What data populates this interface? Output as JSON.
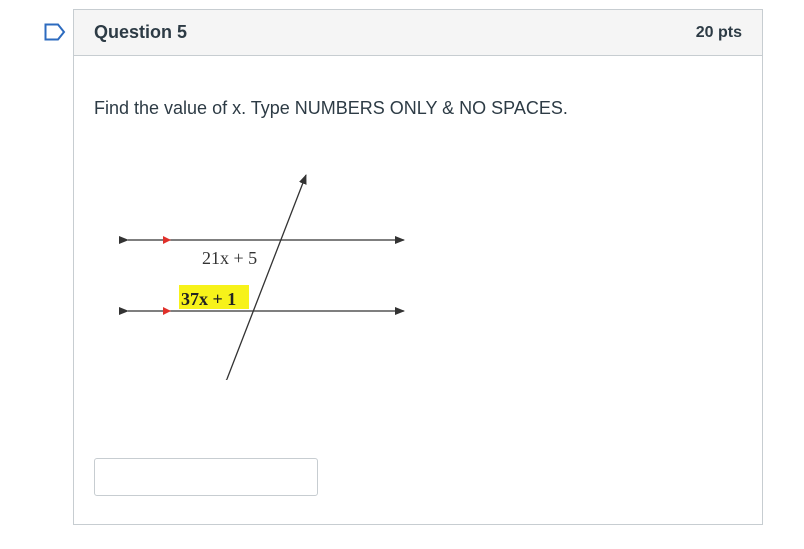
{
  "question": {
    "title": "Question 5",
    "points": "20 pts",
    "text": "Find the value of x.  Type NUMBERS ONLY & NO SPACES.",
    "answer_value": "",
    "answer_placeholder": ""
  },
  "diagram": {
    "upper_angle_label": "21x + 5",
    "lower_angle_label": "37x + 1",
    "highlight_color": "#f7f21a",
    "parallel_marker_color": "#e0302a"
  },
  "icons": {
    "flag": "flag-outline-icon"
  }
}
